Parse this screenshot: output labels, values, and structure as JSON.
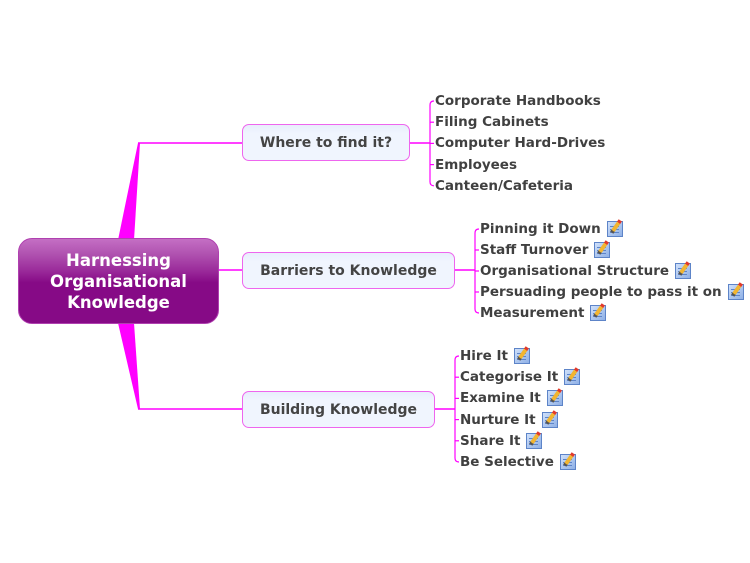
{
  "colors": {
    "connector": "#ff00ff",
    "central_fill": "#860a86",
    "branch_border": "#ee66ee",
    "branch_fill": "#f0f5fe",
    "text": "#444444"
  },
  "central_topic": {
    "lines": [
      "Harnessing",
      "Organisational",
      "Knowledge"
    ]
  },
  "branches": [
    {
      "label": "Where to find it?",
      "children": [
        {
          "label": "Corporate Handbooks",
          "has_note": false
        },
        {
          "label": "Filing Cabinets",
          "has_note": false
        },
        {
          "label": "Computer Hard-Drives",
          "has_note": false
        },
        {
          "label": "Employees",
          "has_note": false
        },
        {
          "label": "Canteen/Cafeteria",
          "has_note": false
        }
      ]
    },
    {
      "label": "Barriers to Knowledge",
      "children": [
        {
          "label": "Pinning it Down",
          "has_note": true,
          "icon": "note-icon"
        },
        {
          "label": "Staff Turnover",
          "has_note": true,
          "icon": "note-icon"
        },
        {
          "label": "Organisational Structure",
          "has_note": true,
          "icon": "note-icon"
        },
        {
          "label": "Persuading people to pass it on",
          "has_note": true,
          "icon": "note-icon"
        },
        {
          "label": "Measurement",
          "has_note": true,
          "icon": "note-icon"
        }
      ]
    },
    {
      "label": "Building Knowledge",
      "children": [
        {
          "label": "Hire It",
          "has_note": true,
          "icon": "note-icon"
        },
        {
          "label": "Categorise It",
          "has_note": true,
          "icon": "note-icon"
        },
        {
          "label": "Examine It",
          "has_note": true,
          "icon": "note-icon"
        },
        {
          "label": "Nurture It",
          "has_note": true,
          "icon": "note-icon"
        },
        {
          "label": "Share It",
          "has_note": true,
          "icon": "note-icon"
        },
        {
          "label": "Be Selective",
          "has_note": true,
          "icon": "note-icon"
        }
      ]
    }
  ]
}
